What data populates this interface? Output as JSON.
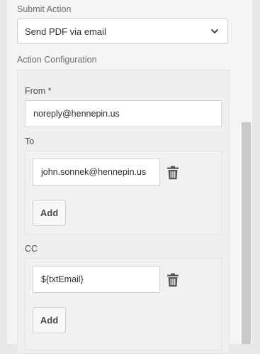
{
  "submit_action": {
    "label": "Submit Action",
    "selected": "Send PDF via email"
  },
  "action_configuration": {
    "label": "Action Configuration",
    "from": {
      "label": "From *",
      "value": "noreply@hennepin.us"
    },
    "to": {
      "label": "To",
      "entries": [
        "john.sonnek@hennepin.us"
      ],
      "add_label": "Add"
    },
    "cc": {
      "label": "CC",
      "entries": [
        "${txtEmail}"
      ],
      "add_label": "Add"
    }
  },
  "icons": {
    "dropdown": "chevron-down-icon",
    "delete": "trash-icon"
  }
}
